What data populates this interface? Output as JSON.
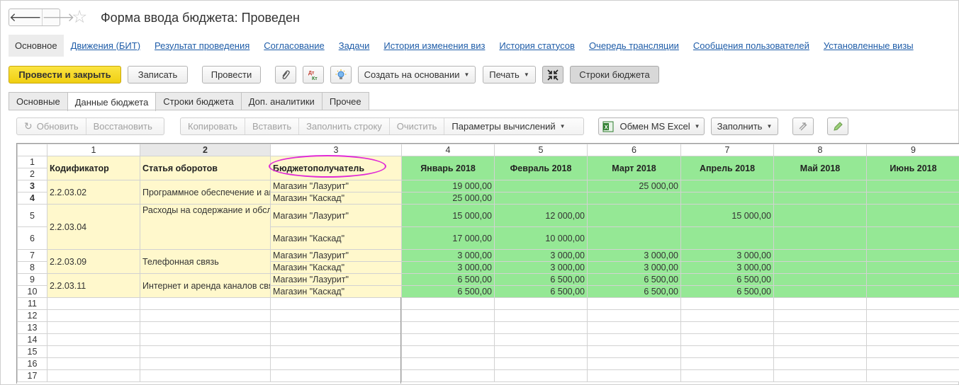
{
  "window": {
    "title": "Форма ввода бюджета: Проведен",
    "back_glyph": "🡐",
    "forward_glyph": "🡒",
    "star_glyph": "☆"
  },
  "top_links": [
    "Основное",
    "Движения (БИТ)",
    "Результат проведения",
    "Согласование",
    "Задачи",
    "История изменения виз",
    "История статусов",
    "Очередь трансляции",
    "Сообщения пользователей",
    "Установленные визы"
  ],
  "toolbar": {
    "post_close": "Провести и закрыть",
    "save": "Записать",
    "post": "Провести",
    "create_based": "Создать на основании",
    "print": "Печать",
    "budget_rows": "Строки бюджета"
  },
  "tabs": [
    "Основные",
    "Данные бюджета",
    "Строки бюджета",
    "Доп. аналитики",
    "Прочее"
  ],
  "grid_toolbar": {
    "refresh": "Обновить",
    "restore": "Восстановить",
    "copy": "Копировать",
    "paste": "Вставить",
    "fill_row": "Заполнить строку",
    "clear": "Очистить",
    "calc_params": "Параметры вычислений",
    "excel": "Обмен MS Excel",
    "fill": "Заполнить"
  },
  "grid": {
    "col_numbers": [
      "1",
      "2",
      "3",
      "4",
      "5",
      "6",
      "7",
      "8",
      "9"
    ],
    "headers": [
      "Кодификатор",
      "Статья оборотов",
      "Бюджетополучатель",
      "Январь 2018",
      "Февраль 2018",
      "Март 2018",
      "Апрель 2018",
      "Май 2018",
      "Июнь 2018"
    ],
    "row_numbers": [
      "1",
      "2",
      "3",
      "4",
      "5",
      "6",
      "7",
      "8",
      "9",
      "10",
      "11",
      "12",
      "13",
      "14",
      "15",
      "16",
      "17"
    ],
    "groups": [
      {
        "code": "2.2.03.02",
        "article": "Программное обеспечение и автоматизация",
        "rows": [
          {
            "recipient": "Магазин \"Лазурит\"",
            "values": [
              "19 000,00",
              "",
              "25 000,00",
              "",
              "",
              ""
            ]
          },
          {
            "recipient": "Магазин \"Каскад\"",
            "values": [
              "25 000,00",
              "",
              "",
              "",
              "",
              ""
            ]
          }
        ]
      },
      {
        "code": "2.2.03.04",
        "article": "Расходы на содержание и обслуживание вычислительной техники и оборудования",
        "rows": [
          {
            "recipient": "Магазин \"Лазурит\"",
            "values": [
              "15 000,00",
              "12 000,00",
              "",
              "15 000,00",
              "",
              ""
            ]
          },
          {
            "recipient": "Магазин \"Каскад\"",
            "values": [
              "17 000,00",
              "10 000,00",
              "",
              "",
              "",
              ""
            ]
          }
        ]
      },
      {
        "code": "2.2.03.09",
        "article": "Телефонная связь",
        "rows": [
          {
            "recipient": "Магазин \"Лазурит\"",
            "values": [
              "3 000,00",
              "3 000,00",
              "3 000,00",
              "3 000,00",
              "",
              ""
            ]
          },
          {
            "recipient": "Магазин \"Каскад\"",
            "values": [
              "3 000,00",
              "3 000,00",
              "3 000,00",
              "3 000,00",
              "",
              ""
            ]
          }
        ]
      },
      {
        "code": "2.2.03.11",
        "article": "Интернет и аренда каналов связи",
        "rows": [
          {
            "recipient": "Магазин \"Лазурит\"",
            "values": [
              "6 500,00",
              "6 500,00",
              "6 500,00",
              "6 500,00",
              "",
              ""
            ]
          },
          {
            "recipient": "Магазин \"Каскад\"",
            "values": [
              "6 500,00",
              "6 500,00",
              "6 500,00",
              "6 500,00",
              "",
              ""
            ]
          }
        ]
      }
    ]
  },
  "colors": {
    "accent_yellow": "#f0cf12",
    "link_blue": "#1e5ca8",
    "cell_green": "#95e895",
    "cell_yellow": "#fff8cc",
    "highlight_oval": "#e02bd6"
  }
}
